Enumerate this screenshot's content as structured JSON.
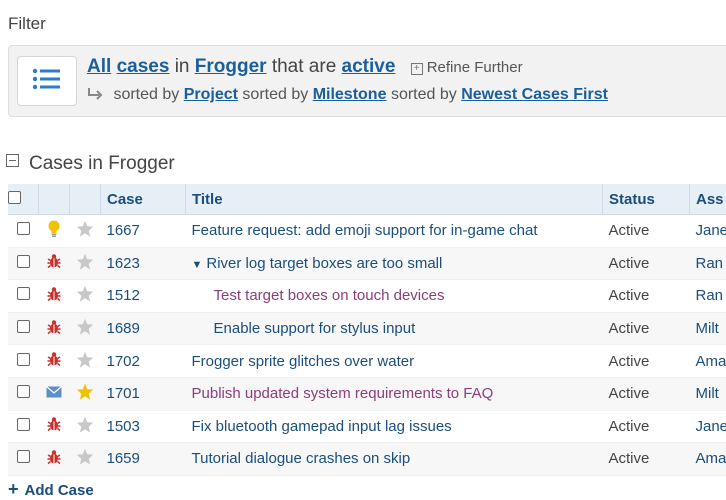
{
  "filter": {
    "heading": "Filter",
    "line1": {
      "all": "All",
      "cases": "cases",
      "in": "in",
      "project": "Frogger",
      "that_are": "that are",
      "status": "active",
      "refine": "Refine Further"
    },
    "line2": {
      "sorted_by_1": "sorted by",
      "sort1": "Project",
      "sorted_by_2": "sorted by",
      "sort2": "Milestone",
      "sorted_by_3": "sorted by",
      "sort3": "Newest Cases First"
    }
  },
  "section": {
    "title": "Cases in Frogger"
  },
  "table": {
    "headers": {
      "case": "Case",
      "title": "Title",
      "status": "Status",
      "assigned": "Ass"
    },
    "rows": [
      {
        "type": "idea",
        "starred": false,
        "case": "1667",
        "title": "Feature request: add emoji support for in-game chat",
        "status": "Active",
        "assignee": "Jane",
        "indent": 0,
        "color": "blue",
        "caret": false
      },
      {
        "type": "bug",
        "starred": false,
        "case": "1623",
        "title": "River log target boxes are too small",
        "status": "Active",
        "assignee": "Ran",
        "indent": 0,
        "color": "blue",
        "caret": true
      },
      {
        "type": "bug",
        "starred": false,
        "case": "1512",
        "title": "Test target boxes on touch devices",
        "status": "Active",
        "assignee": "Ran",
        "indent": 1,
        "color": "purple",
        "caret": false
      },
      {
        "type": "bug",
        "starred": false,
        "case": "1689",
        "title": "Enable support for stylus input",
        "status": "Active",
        "assignee": "Milt",
        "indent": 1,
        "color": "blue",
        "caret": false
      },
      {
        "type": "bug",
        "starred": false,
        "case": "1702",
        "title": "Frogger sprite glitches over water",
        "status": "Active",
        "assignee": "Ama",
        "indent": 0,
        "color": "blue",
        "caret": false
      },
      {
        "type": "inquiry",
        "starred": true,
        "case": "1701",
        "title": "Publish updated system requirements to FAQ",
        "status": "Active",
        "assignee": "Milt",
        "indent": 0,
        "color": "purple",
        "caret": false
      },
      {
        "type": "bug",
        "starred": false,
        "case": "1503",
        "title": "Fix bluetooth gamepad input lag issues",
        "status": "Active",
        "assignee": "Jane",
        "indent": 0,
        "color": "blue",
        "caret": false
      },
      {
        "type": "bug",
        "starred": false,
        "case": "1659",
        "title": "Tutorial dialogue crashes on skip",
        "status": "Active",
        "assignee": "Ama",
        "indent": 0,
        "color": "blue",
        "caret": false
      }
    ]
  },
  "actions": {
    "add_case": "Add Case"
  },
  "icons": {
    "filter": "list-icon",
    "idea": "lightbulb-icon",
    "bug": "bug-icon",
    "inquiry": "envelope-icon",
    "star": "star-icon"
  },
  "colors": {
    "link": "#1a5f9c",
    "purple_title": "#8c3d7a",
    "bug": "#c9302c",
    "idea": "#f2c100",
    "inquiry": "#5b8fc9",
    "star_on": "#f2c100",
    "star_off": "#c8c8c8",
    "header_bg": "#e6eef6"
  }
}
